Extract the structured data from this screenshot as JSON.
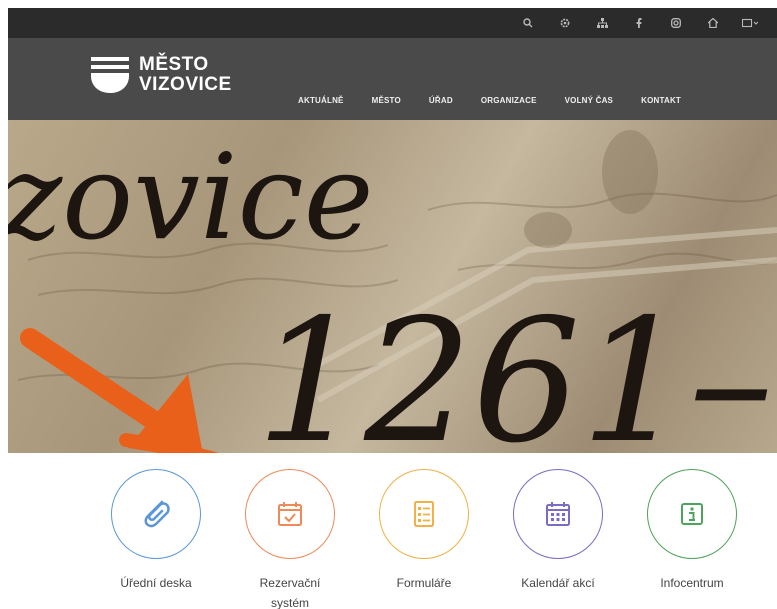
{
  "brand": {
    "line1": "MĚSTO",
    "line2": "VIZOVICE"
  },
  "top_icons": [
    "search-icon",
    "gear-icon",
    "sitemap-icon",
    "facebook-icon",
    "instagram-icon",
    "home-icon",
    "language-icon"
  ],
  "menu": [
    {
      "label": "AKTUÁLNĚ"
    },
    {
      "label": "MĚSTO"
    },
    {
      "label": "ÚŘAD"
    },
    {
      "label": "ORGANIZACE"
    },
    {
      "label": "VOLNÝ ČAS"
    },
    {
      "label": "KONTAKT"
    }
  ],
  "hero": {
    "script_word": "zovice",
    "script_year": "1261–"
  },
  "quick_links": [
    {
      "label": "Úřední deska",
      "icon": "paperclip-icon",
      "color": "#5b97d8"
    },
    {
      "label": "Rezervační systém",
      "icon": "calendar-check-icon",
      "color": "#ee8a5a"
    },
    {
      "label": "Formuláře",
      "icon": "form-list-icon",
      "color": "#f2b046"
    },
    {
      "label": "Kalendář akcí",
      "icon": "calendar-grid-icon",
      "color": "#7c6bc4"
    },
    {
      "label": "Infocentrum",
      "icon": "info-icon",
      "color": "#4fa35a"
    }
  ],
  "annotation_color": "#e8601a"
}
